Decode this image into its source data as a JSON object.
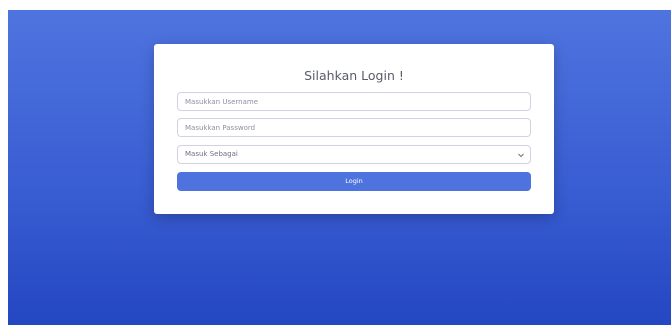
{
  "login": {
    "title": "Silahkan Login !",
    "username_placeholder": "Masukkan Username",
    "password_placeholder": "Masukkan Password",
    "role_select": {
      "selected": "Masuk Sebagai"
    },
    "submit_label": "Login"
  },
  "colors": {
    "background_top": "#4f74df",
    "background_bottom": "#2447c2",
    "button": "#4e73df"
  },
  "icons": {
    "select_arrow": "chevron-down-icon"
  }
}
